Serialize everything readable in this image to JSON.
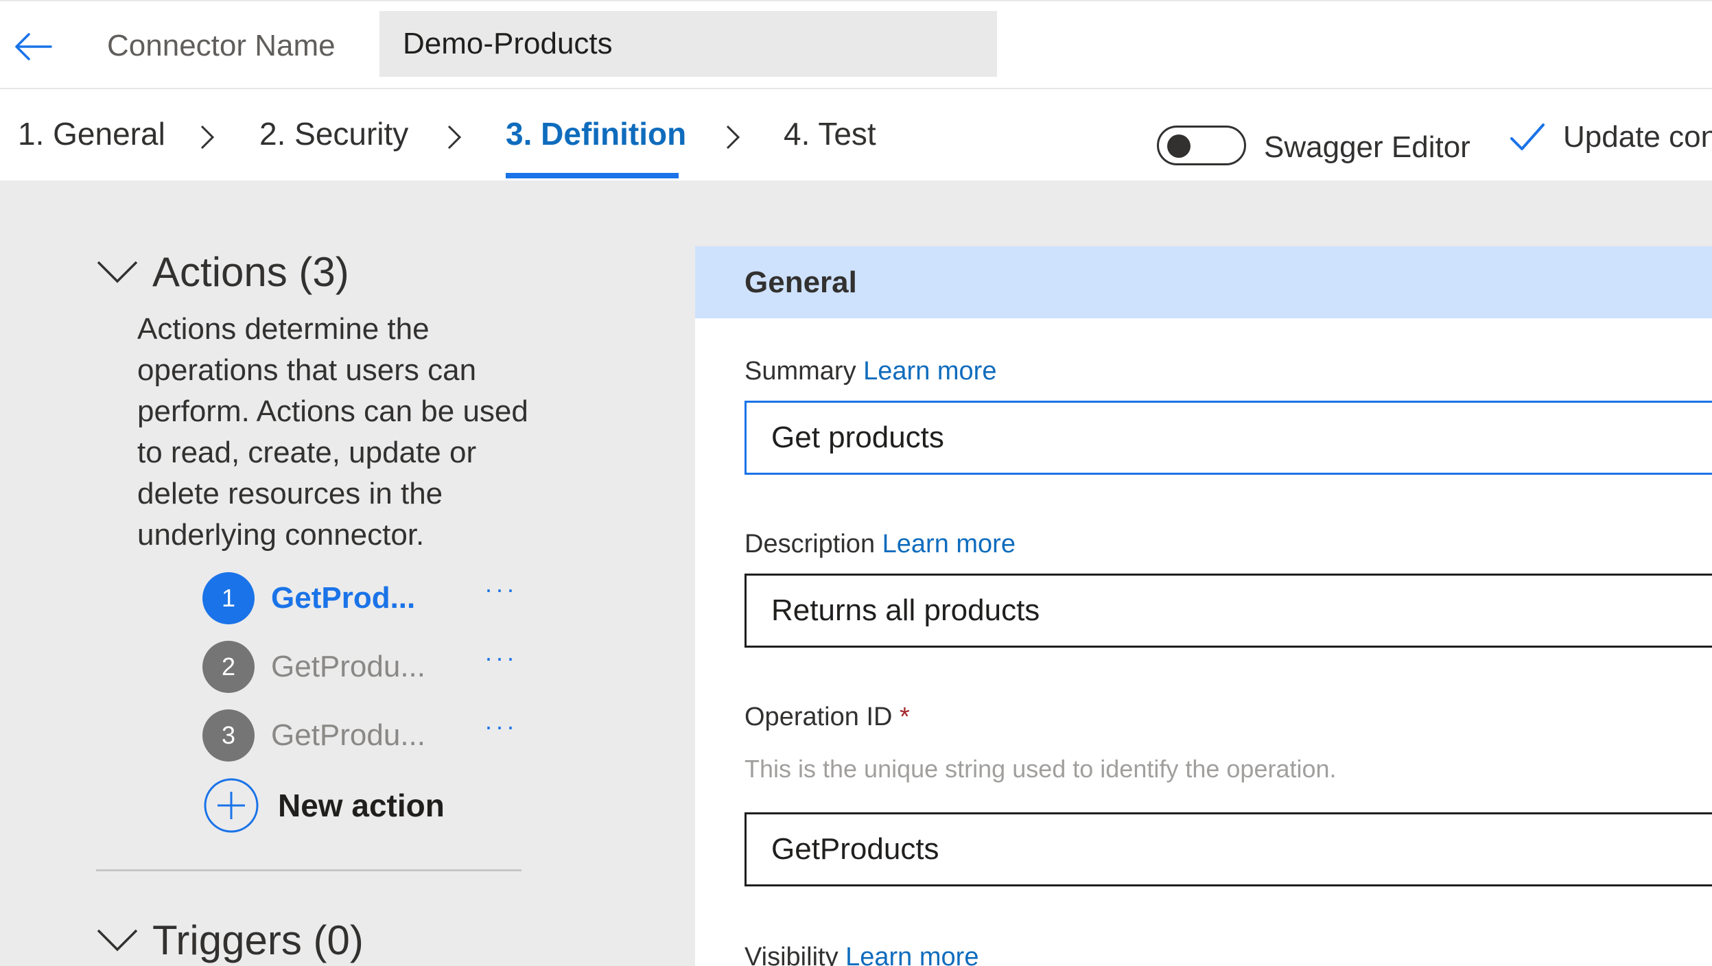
{
  "header": {
    "back_icon": "arrow-left-icon",
    "connector_label": "Connector Name",
    "connector_value": "Demo-Products"
  },
  "steps": [
    {
      "label": "1. General",
      "active": false
    },
    {
      "label": "2. Security",
      "active": false
    },
    {
      "label": "3. Definition",
      "active": true
    },
    {
      "label": "4. Test",
      "active": false
    }
  ],
  "toolbar": {
    "swagger_label": "Swagger Editor",
    "swagger_on": false,
    "update_label": "Update conn"
  },
  "actions": {
    "title": "Actions (3)",
    "description": "Actions determine the operations that users can perform. Actions can be used to read, create, update or delete resources in the underlying connector.",
    "items": [
      {
        "number": "1",
        "name": "GetProd...",
        "active": true,
        "more": "···"
      },
      {
        "number": "2",
        "name": "GetProdu...",
        "active": false,
        "more": "···"
      },
      {
        "number": "3",
        "name": "GetProdu...",
        "active": false,
        "more": "···"
      }
    ],
    "new_action_label": "New action"
  },
  "triggers": {
    "title": "Triggers (0)"
  },
  "general": {
    "title": "General",
    "summary": {
      "label": "Summary",
      "link": "Learn more",
      "value": "Get products"
    },
    "description": {
      "label": "Description",
      "link": "Learn more",
      "value": "Returns all products"
    },
    "operation_id": {
      "label": "Operation ID",
      "required_mark": "*",
      "hint": "This is the unique string used to identify the operation.",
      "value": "GetProducts"
    },
    "visibility": {
      "label": "Visibility",
      "link": "Learn more"
    }
  },
  "colors": {
    "accent": "#1a73e8",
    "header_band": "#cfe2fd",
    "panel_bg": "#ebebeb"
  }
}
